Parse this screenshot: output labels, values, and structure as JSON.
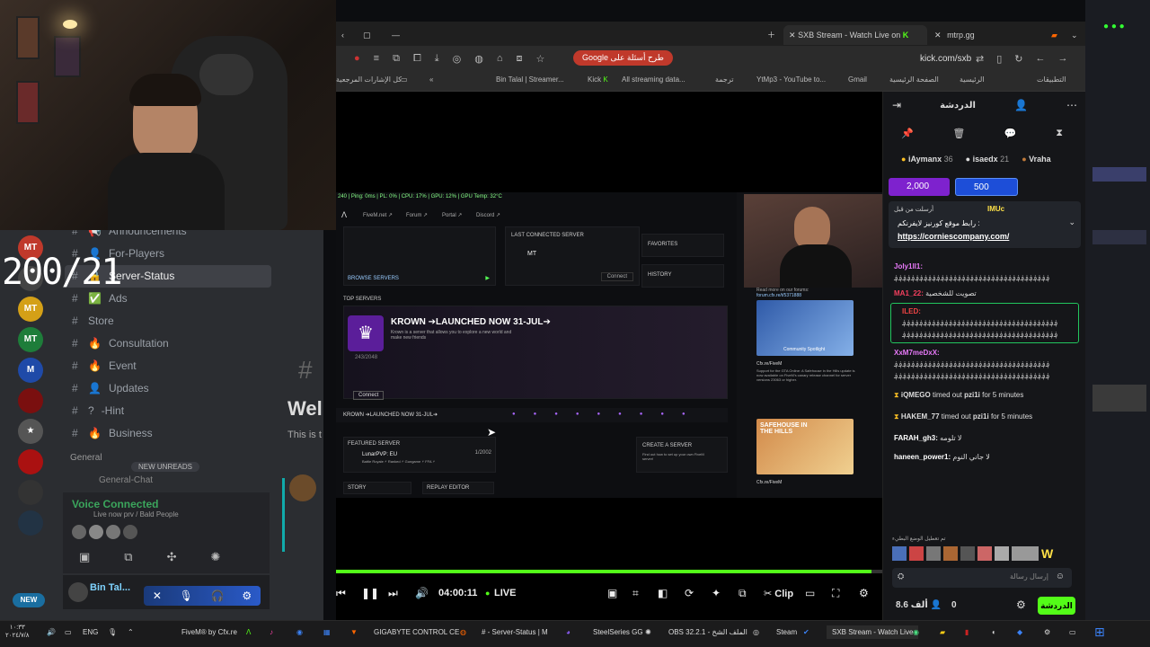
{
  "overlay_counter": "200/21",
  "discord": {
    "channels": [
      "Announcements",
      "For-Players",
      "Server-Status",
      "Ads",
      "Store",
      "Consultation",
      "Event",
      "Updates",
      "-Hint",
      "Business"
    ],
    "category": "General",
    "new_unreads": "NEW UNREADS",
    "general_chat": "General-Chat",
    "voice_status": "Voice Connected",
    "voice_sub": "Live now prv / Bald People",
    "user_name": "Bin Tal...",
    "welcome": "Wel",
    "this_is": "This is t",
    "new_badge": "NEW",
    "guild_labels": [
      "MT",
      "MT",
      "MT"
    ]
  },
  "browser": {
    "tabs": {
      "kick": "SXB Stream - Watch Live on",
      "mtrp": "mtrp.gg"
    },
    "search_chip": "Google طرح أسئلة على",
    "url": "kick.com/sxb",
    "bookmarks": [
      "كل الإشارات المرجعية",
      "Bin Talal | Streamer...",
      "Kick",
      "All streaming data...",
      "ترجمة",
      "YtMp3 - YouTube to...",
      "Gmail",
      "الصفحة الرئيسية",
      "الرئيسية",
      "التطبيقات"
    ]
  },
  "fivem": {
    "nav": [
      "FiveM.net ↗",
      "Forum ↗",
      "Portal ↗",
      "Discord ↗"
    ],
    "browse": "BROWSE SERVERS",
    "last_connected": "LAST CONNECTED SERVER",
    "last_server": "MT",
    "connect": "Connect",
    "favorites": "FAVORITES",
    "history": "HISTORY",
    "top_servers": "TOP SERVERS",
    "server_title": "KROWN ➔LAUNCHED NOW 31-JUL➔",
    "server_desc": "Krown is a server that allows you to explore a new world and make new friends",
    "players": "243/2048",
    "connect_btn": "Connect",
    "strip_title": "KROWN ➔LAUNCHED NOW 31-JUL➔",
    "featured": "FEATURED SERVER",
    "featured_name": "LunarPVP: EU",
    "featured_sub": "Battle Royale ⚡ Ranked ⚡ Gungame ⚡ FFA ⚡",
    "featured_count": "1/2002",
    "create": "CREATE A SERVER",
    "create_sub": "Find out how to set up your own FiveM server!",
    "story": "STORY",
    "replay": "REPLAY EDITOR",
    "cfx": "Cfx.re/FiveM",
    "news_text": "Support for the GTA Online: A Safehouse in the Hills update is now available on FiveM's canary release channel for server versions 23063 or higher.",
    "forum_link": "forum.cfx.re/t/5371888",
    "read_more": "Read more on our forums:",
    "spotlight": "Community Spotlight",
    "safehouse": "SAFEHOUSE IN THE HILLS"
  },
  "player": {
    "time": "04:00:11",
    "live": "LIVE",
    "clip": "Clip",
    "progress": 0.98
  },
  "chat": {
    "header": "الدردشة",
    "leaders": [
      {
        "name": "iAymanx",
        "n": "36"
      },
      {
        "name": "isaedx",
        "n": "21"
      },
      {
        "name": "Vraha",
        "n": ""
      }
    ],
    "gift1": "2,000",
    "gift2": "500",
    "pinned_user": "IMUc",
    "pinned_text": "رابط موقع كورنيز لايفرنكم :",
    "pinned_link": "https://corniescompany.com/",
    "pinned_tag": "أرسلت من قبل",
    "messages": [
      {
        "user": "Joly1ll1:",
        "color": "#e879f9",
        "text": "؋؋؋؋؋؋؋؋؋؋؋؋؋؋؋؋؋؋؋؋؋؋؋؋؋؋؋؋؋؋؋؋؋؋؋؋؋"
      },
      {
        "user": "MA1_22:",
        "color": "#f43f5e",
        "text": "تصويت للشخصية"
      },
      {
        "user": "ILED:",
        "color": "#ef4444",
        "text": "؋؋؋؋؋؋؋؋؋؋؋؋؋؋؋؋؋؋؋؋؋؋؋؋؋؋؋؋؋؋؋؋؋؋؋؋؋"
      },
      {
        "user": "XxM7meDxX:",
        "color": "#e879f9",
        "text": "؋؋؋؋؋؋؋؋؋؋؋؋؋؋؋؋؋؋؋؋؋؋؋؋؋؋؋؋؋؋؋؋؋؋؋؋؋"
      }
    ],
    "timeouts": [
      {
        "who": "iQMEGO",
        "what": "timed out",
        "target": "pzi1i",
        "dur": "for 5 minutes"
      },
      {
        "who": "HAKEM_77",
        "what": "timed out",
        "target": "pzi1i",
        "dur": "for 5 minutes"
      }
    ],
    "farah": "FARAH_gh3:",
    "farah_text": "لا تلومه",
    "haneen": "haneen_power1:",
    "haneen_text": "لا جاني النوم",
    "emote_caption": "تم تعطيل الوضع البطيء",
    "input_placeholder": "إرسال رسالة",
    "viewers": "8.6 ألف",
    "zero": "0",
    "send_btn": "الدردشة"
  },
  "taskbar": {
    "time": "١٠:٣٣",
    "date": "٢٠٢٤/٧/٨",
    "lang": "ENG",
    "items": [
      "FiveM® by Cfx.re",
      "GIGABYTE CONTROL CE",
      "# - Server-Status | M",
      "SteelSeries GG",
      "OBS 32.2.1 - الملف الشخ",
      "Steam",
      "SXB Stream - Watch Live"
    ]
  },
  "colors": {
    "kick_green": "#53fc18",
    "discord_bg": "#2b2d31",
    "chat_bg": "#151619"
  }
}
